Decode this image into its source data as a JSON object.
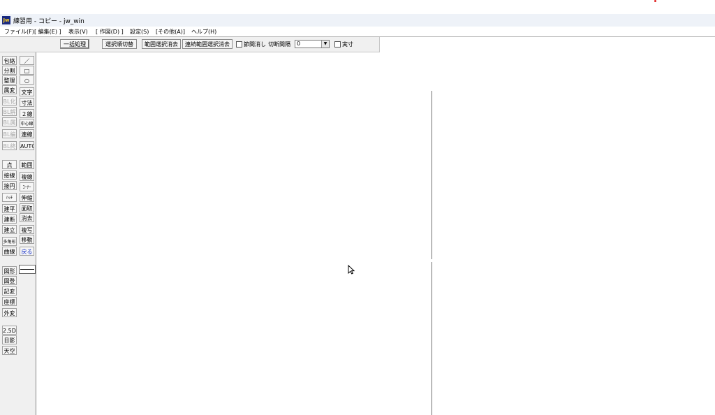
{
  "window": {
    "title": "練習用 - コピー - jw_win",
    "icon_label": "Jw"
  },
  "menu": [
    "ファイル(F)",
    "[ 編集(E) ]",
    "表示(V)",
    "[ 作図(D) ]",
    "設定(S)",
    "[その他(A)]",
    "ヘルプ(H)"
  ],
  "toolbar": {
    "batch_button": "一括処理",
    "select_order_button": "選択順切替",
    "range_delete_button": "範囲選択消去",
    "continuous_range_delete_button": "連続範囲選択消去",
    "node_delete_label": "節間消し",
    "cut_interval_label": "切断間隔",
    "cut_interval_value": "0",
    "actual_size_label": "実寸"
  },
  "left_tools": {
    "col1_top": [
      "包絡",
      "分割",
      "整理",
      "属変",
      "BL化",
      "BL解",
      "BL属",
      "BL編",
      "BL終"
    ],
    "col2_top": [
      "／",
      "□",
      "○",
      "文字",
      "寸法",
      "２線",
      "中心線",
      "連線",
      "AUTO"
    ],
    "col1_mid": [
      "点",
      "接線",
      "接円",
      "ﾊｯﾁ",
      "建平",
      "建断",
      "建立",
      "多角形",
      "曲線"
    ],
    "col2_mid": [
      "範囲",
      "複線",
      "ｺｰﾅｰ",
      "伸縮",
      "面取",
      "消去",
      "複写",
      "移動",
      "戻る"
    ],
    "col1_bottom": [
      "図形",
      "図登",
      "記変",
      "座標",
      "外変",
      "2.5D",
      "日影",
      "天空"
    ]
  },
  "icons": {
    "cursor": "arrow-cursor-icon",
    "combo": "chevron-down-icon"
  },
  "colors": {
    "accent_blue": "#1530c8",
    "disabled_grey": "#a8a8a8",
    "title_bg": "#eef2f8"
  }
}
